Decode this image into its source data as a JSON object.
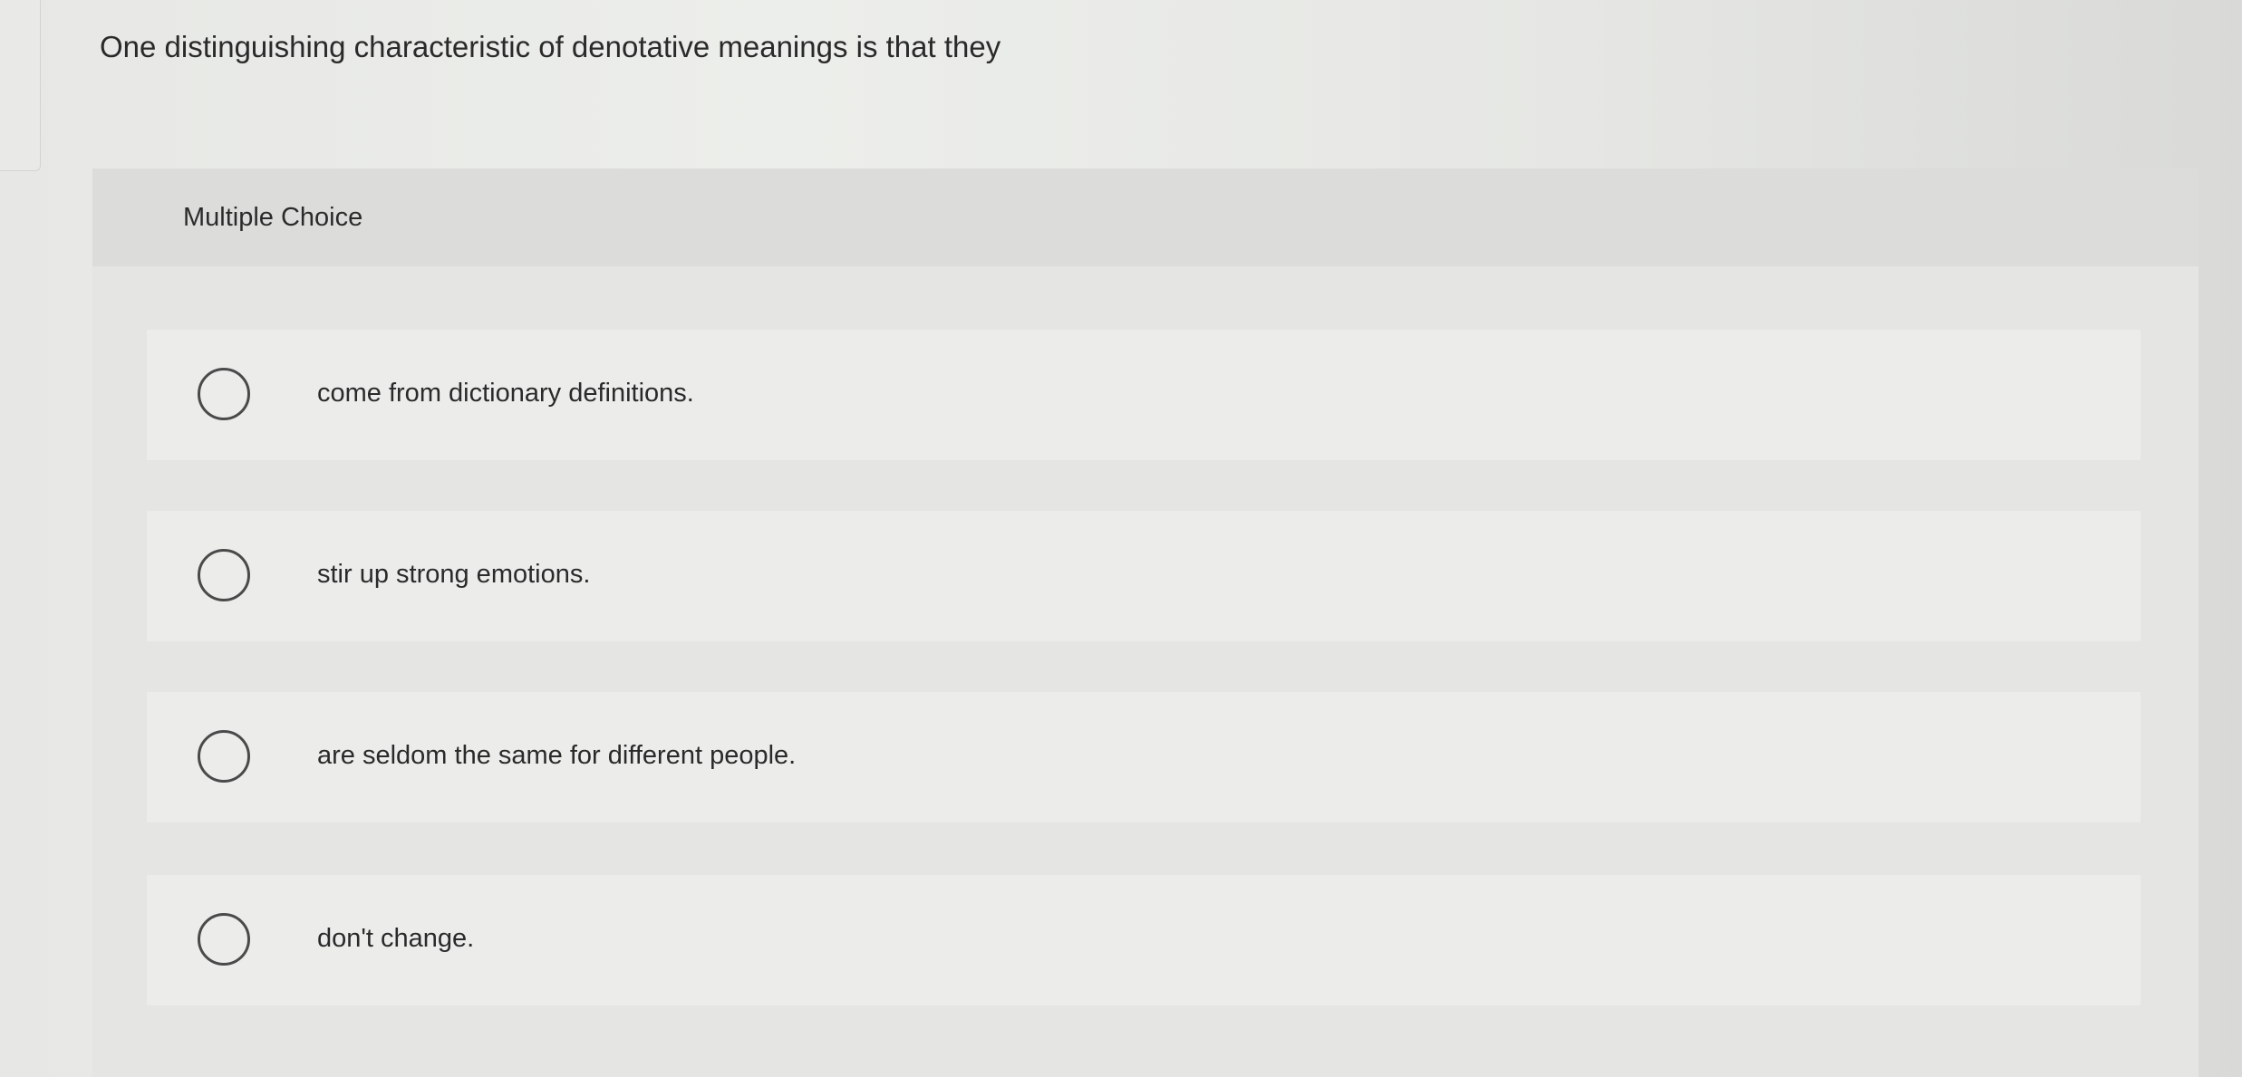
{
  "question": {
    "text": "One distinguishing characteristic of denotative meanings is that they"
  },
  "panel": {
    "type_label": "Multiple Choice"
  },
  "options": [
    {
      "label": "come from dictionary definitions.",
      "selected": false
    },
    {
      "label": "stir up strong emotions.",
      "selected": false
    },
    {
      "label": "are seldom the same for different people.",
      "selected": false
    },
    {
      "label": "don't change.",
      "selected": false
    }
  ]
}
